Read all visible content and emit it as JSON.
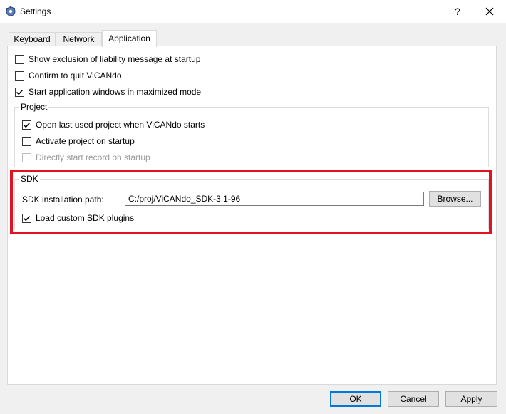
{
  "window": {
    "title": "Settings",
    "help_label": "?"
  },
  "tabs": [
    {
      "label": "Keyboard",
      "active": false
    },
    {
      "label": "Network",
      "active": false
    },
    {
      "label": "Application",
      "active": true
    }
  ],
  "options": {
    "show_liability": {
      "label": "Show exclusion of liability message at startup",
      "checked": false
    },
    "confirm_quit": {
      "label": "Confirm to quit ViCANdo",
      "checked": false
    },
    "maximized": {
      "label": "Start application windows in maximized mode",
      "checked": true
    }
  },
  "project": {
    "title": "Project",
    "open_last": {
      "label": "Open last used project when ViCANdo starts",
      "checked": true
    },
    "activate": {
      "label": "Activate project on startup",
      "checked": false
    },
    "direct_record": {
      "label": "Directly start record  on startup",
      "checked": false,
      "disabled": true
    }
  },
  "sdk": {
    "title": "SDK",
    "path_label": "SDK installation path:",
    "path_value": "C:/proj/ViCANdo_SDK-3.1-96",
    "browse_label": "Browse...",
    "load_plugins": {
      "label": "Load custom SDK plugins",
      "checked": true
    }
  },
  "footer": {
    "ok_label": "OK",
    "cancel_label": "Cancel",
    "apply_label": "Apply"
  },
  "colors": {
    "highlight": "#e0131f",
    "default_button_border": "#0078d7"
  }
}
